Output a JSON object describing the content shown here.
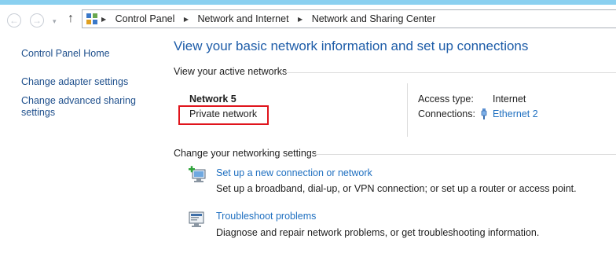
{
  "address_bar": {
    "breadcrumbs": [
      "Control Panel",
      "Network and Internet",
      "Network and Sharing Center"
    ]
  },
  "nav": {
    "back_glyph": "←",
    "forward_glyph": "→",
    "recent_glyph": "▾",
    "up_glyph": "↑"
  },
  "sidebar": {
    "home_link": "Control Panel Home",
    "adapter_link": "Change adapter settings",
    "sharing_link": "Change advanced sharing settings"
  },
  "main": {
    "title": "View your basic network information and set up connections",
    "active_networks_label": "View your active networks",
    "network": {
      "name": "Network  5",
      "type": "Private network",
      "access_type_label": "Access type:",
      "access_type_value": "Internet",
      "connections_label": "Connections:",
      "connection_value": "Ethernet 2"
    },
    "change_settings_label": "Change your networking settings",
    "tasks": [
      {
        "link": "Set up a new connection or network",
        "description": "Set up a broadband, dial-up, or VPN connection; or set up a router or access point.",
        "icon": "new-connection-icon"
      },
      {
        "link": "Troubleshoot problems",
        "description": "Diagnose and repair network problems, or get troubleshooting information.",
        "icon": "troubleshoot-icon"
      }
    ]
  },
  "colors": {
    "link": "#1e6fc0",
    "title": "#1d5ca8",
    "highlight_box": "#e0141c",
    "top_strip": "#8ad0f0"
  }
}
